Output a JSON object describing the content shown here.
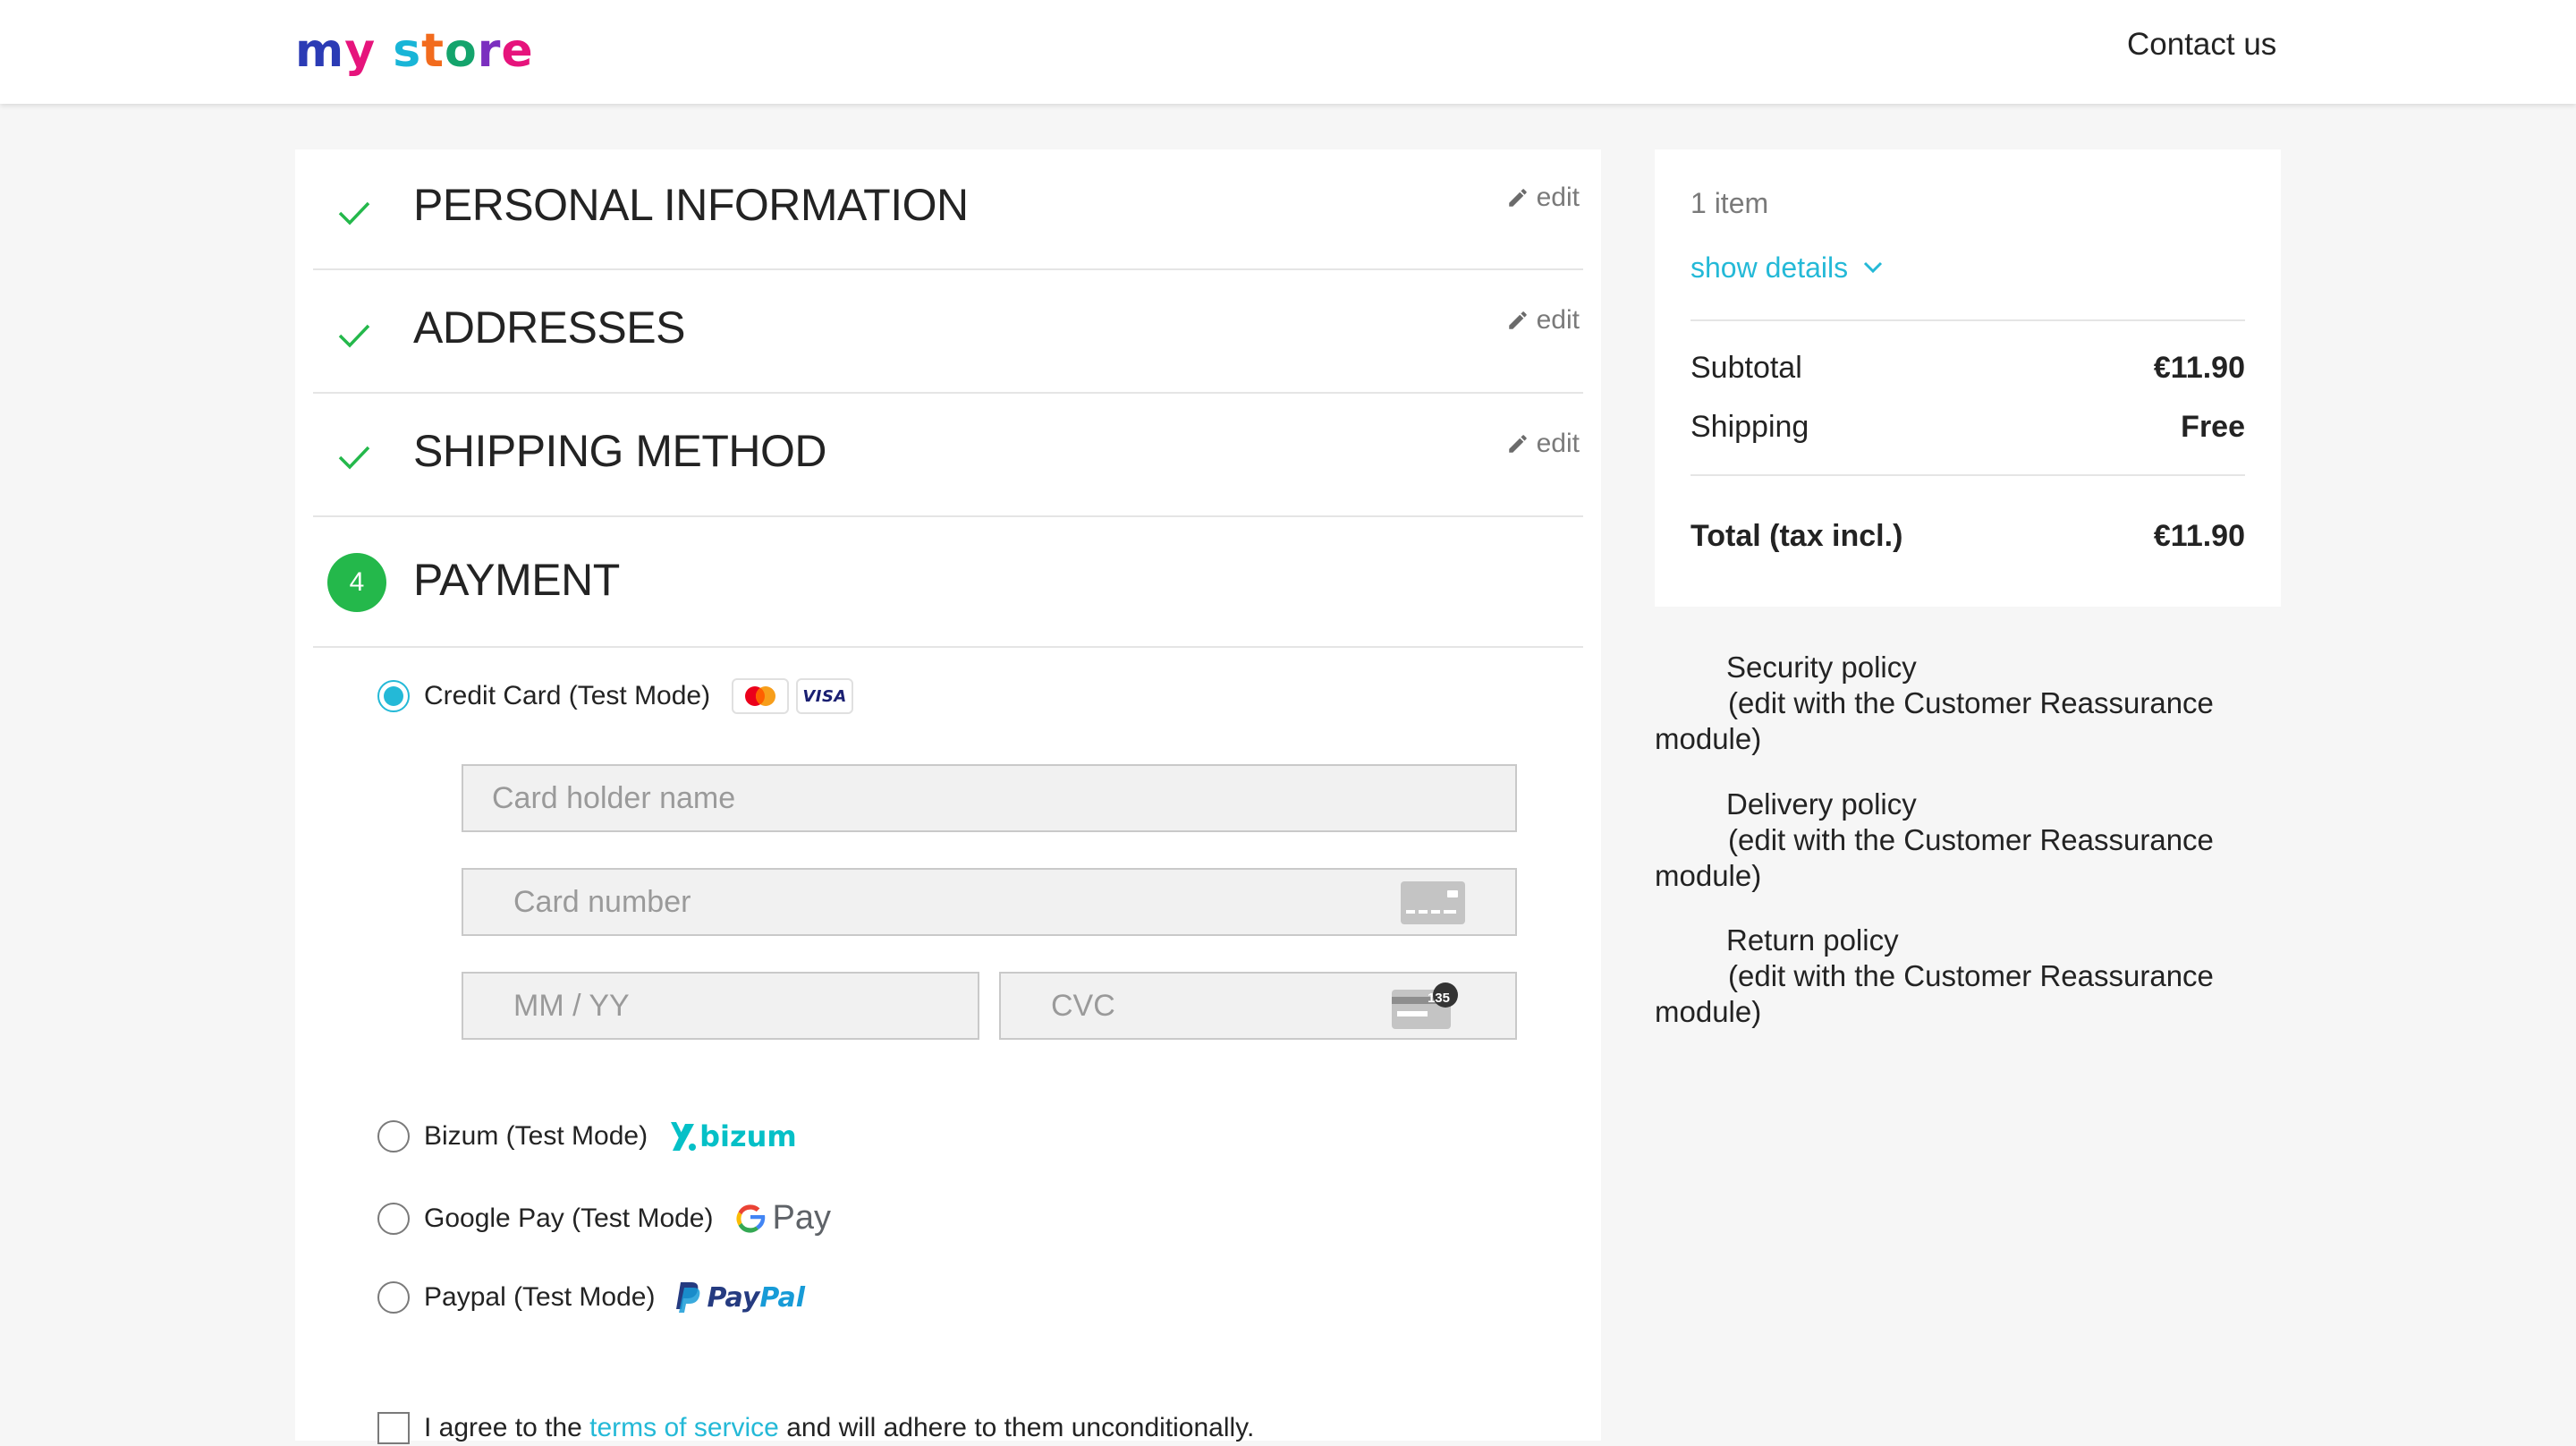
{
  "header": {
    "logo_letters": [
      "m",
      "y",
      " ",
      "s",
      "t",
      "o",
      "r",
      "e"
    ],
    "contact_label": "Contact us"
  },
  "steps": [
    {
      "title": "PERSONAL INFORMATION",
      "edit_label": "edit",
      "status": "complete"
    },
    {
      "title": "ADDRESSES",
      "edit_label": "edit",
      "status": "complete"
    },
    {
      "title": "SHIPPING METHOD",
      "edit_label": "edit",
      "status": "complete"
    },
    {
      "number": "4",
      "title": "PAYMENT",
      "status": "current"
    }
  ],
  "payment": {
    "options": [
      {
        "label": "Credit Card (Test Mode)",
        "selected": true,
        "icons": [
          "mastercard-icon",
          "visa-icon"
        ]
      },
      {
        "label": "Bizum (Test Mode)",
        "selected": false,
        "logo_text": "bizum"
      },
      {
        "label": "Google Pay (Test Mode)",
        "selected": false,
        "logo_text": "Pay"
      },
      {
        "label": "Paypal (Test Mode)",
        "selected": false,
        "logo_text_1": "Pay",
        "logo_text_2": "Pal"
      }
    ],
    "visa_text": "VISA",
    "card_holder_placeholder": "Card holder name",
    "card_number_placeholder": "Card number",
    "expiry_placeholder": "MM / YY",
    "cvc_placeholder": "CVC",
    "cvc_badge": "135"
  },
  "terms": {
    "prefix": "I agree to the ",
    "link": "terms of service",
    "suffix": " and will adhere to them unconditionally."
  },
  "summary": {
    "items_count": "1 item",
    "show_details": "show details",
    "subtotal_label": "Subtotal",
    "subtotal_value": "€11.90",
    "shipping_label": "Shipping",
    "shipping_value": "Free",
    "total_label": "Total (tax incl.)",
    "total_value": "€11.90"
  },
  "reassurance": [
    {
      "title": "Security policy",
      "desc": "(edit with the Customer Reassurance",
      "desc2": "module)"
    },
    {
      "title": "Delivery policy",
      "desc": "(edit with the Customer Reassurance",
      "desc2": "module)"
    },
    {
      "title": "Return policy",
      "desc": "(edit with the Customer Reassurance",
      "desc2": "module)"
    }
  ],
  "colors": {
    "accent": "#24b9d7",
    "step_complete": "#24b84b",
    "background": "#f6f6f6"
  }
}
